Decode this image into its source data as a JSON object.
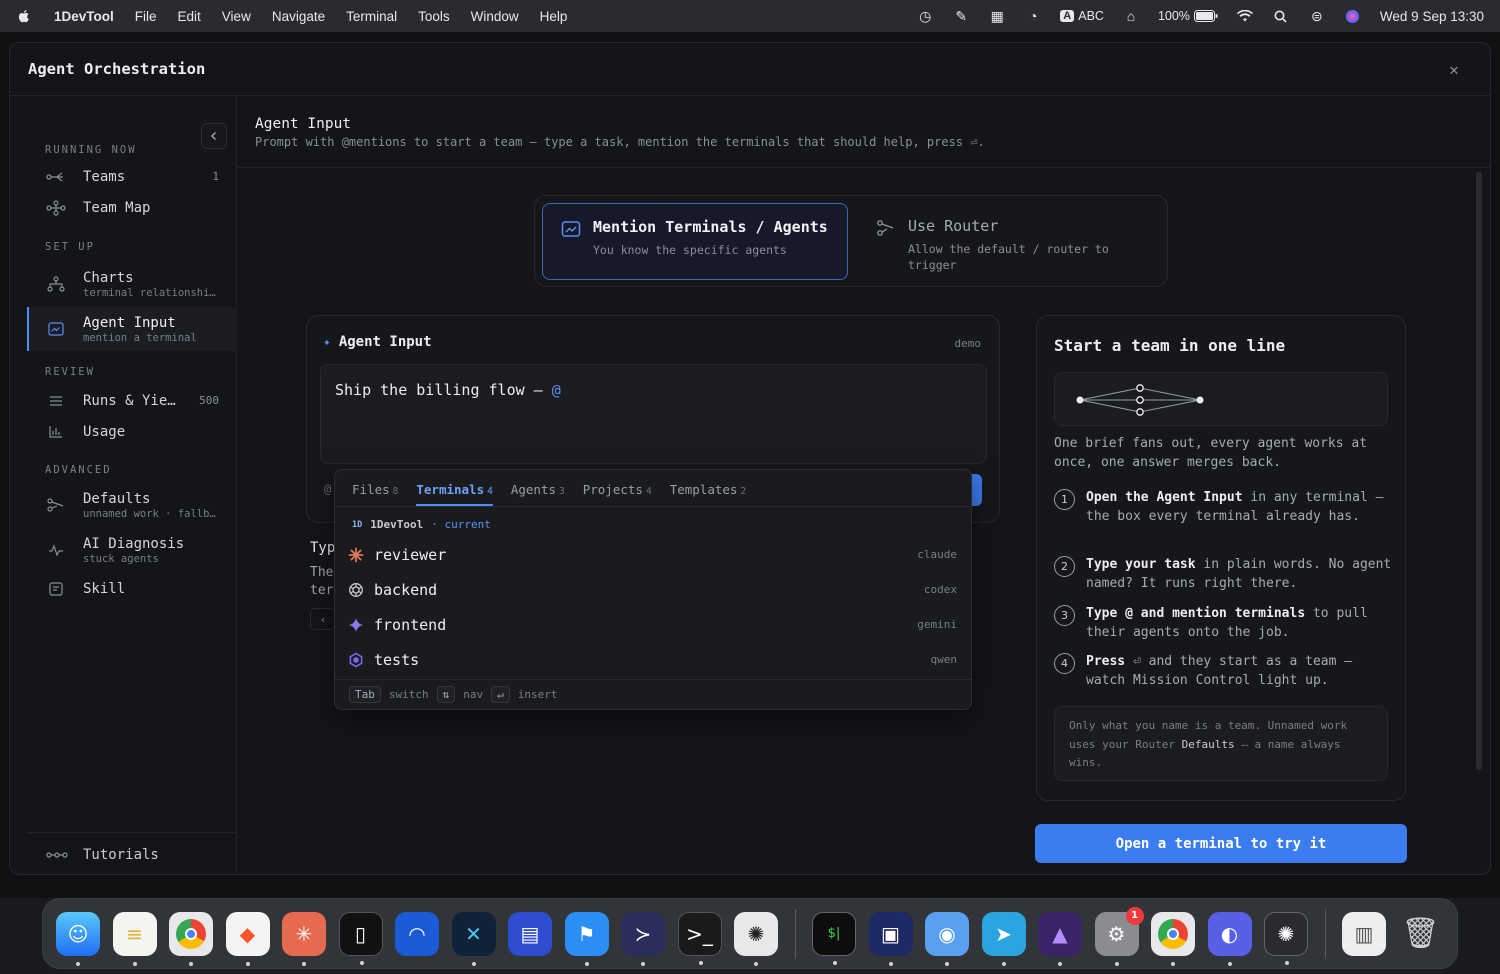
{
  "menubar": {
    "app_name": "1DevTool",
    "menus": [
      "File",
      "Edit",
      "View",
      "Navigate",
      "Terminal",
      "Tools",
      "Window",
      "Help"
    ],
    "input_source": "ABC",
    "battery": "100%",
    "datetime": "Wed 9 Sep  13:30"
  },
  "modal": {
    "title": "Agent Orchestration"
  },
  "sidebar": {
    "sections": {
      "running_now": "RUNNING NOW",
      "set_up": "SET UP",
      "review": "REVIEW",
      "advanced": "ADVANCED"
    },
    "items": {
      "teams": {
        "label": "Teams",
        "count": "1"
      },
      "team_map": {
        "label": "Team Map"
      },
      "charts": {
        "label": "Charts",
        "sub": "terminal relationshi…"
      },
      "agent_input": {
        "label": "Agent Input",
        "sub": "mention a terminal"
      },
      "runs": {
        "label": "Runs & Yie…",
        "count": "500"
      },
      "usage": {
        "label": "Usage"
      },
      "defaults": {
        "label": "Defaults",
        "sub": "unnamed work · fallb…"
      },
      "ai_diagnosis": {
        "label": "AI Diagnosis",
        "sub": "stuck agents"
      },
      "skill": {
        "label": "Skill"
      }
    },
    "footer": {
      "label": "Tutorials"
    }
  },
  "content": {
    "title": "Agent Input",
    "subtitle": "Prompt with @mentions to start a team — type a task, mention the terminals that should help, press ⏎."
  },
  "mode_toggle": {
    "mention": {
      "title": "Mention Terminals / Agents",
      "sub": "You know the specific agents"
    },
    "router": {
      "title": "Use Router",
      "sub": "Allow the default / router to trigger"
    }
  },
  "input_card": {
    "title": "Agent Input",
    "tag": "demo",
    "text": "Ship the billing flow — ",
    "at": "@",
    "left_edge": "@"
  },
  "occluded": {
    "heading": "Typ",
    "line1": "The",
    "line2": "ter",
    "btn": "‹"
  },
  "popup": {
    "tabs": [
      {
        "label": "Files",
        "count": "8"
      },
      {
        "label": "Terminals",
        "count": "4"
      },
      {
        "label": "Agents",
        "count": "3"
      },
      {
        "label": "Projects",
        "count": "4"
      },
      {
        "label": "Templates",
        "count": "2"
      }
    ],
    "group": {
      "badge": "1D",
      "name": "1DevTool",
      "current": "· current"
    },
    "rows": [
      {
        "name": "reviewer",
        "agent": "claude"
      },
      {
        "name": "backend",
        "agent": "codex"
      },
      {
        "name": "frontend",
        "agent": "gemini"
      },
      {
        "name": "tests",
        "agent": "qwen"
      }
    ],
    "footer": {
      "tab": "Tab",
      "switch": "switch",
      "nav_key": "⇅",
      "nav": "nav",
      "insert_key": "↵",
      "insert": "insert"
    }
  },
  "team_card": {
    "title": "Start a team in one line",
    "desc": "One brief fans out, every agent works at once, one answer merges back.",
    "steps": [
      {
        "num": "1",
        "bold": "Open the Agent Input",
        "rest": " in any terminal — the box every terminal already has."
      },
      {
        "num": "2",
        "bold": "Type your task",
        "rest": " in plain words. No agent named? It runs right there."
      },
      {
        "num": "3",
        "bold": "Type @ and mention terminals",
        "rest": " to pull their agents onto the job."
      },
      {
        "num": "4",
        "bold": "Press",
        "rest": " ⏎ and they start as a team — watch Mission Control light up."
      }
    ],
    "note_pre": "Only what you name is a team. Unnamed work uses your Router ",
    "note_bold": "Defaults",
    "note_post": " — a name always wins."
  },
  "cta": {
    "label": "Open a terminal to try it"
  },
  "dock": {
    "badge": "1",
    "apps": [
      "finder",
      "notes",
      "chrome",
      "brave",
      "claude",
      "1devtool",
      "app-blue",
      "app-cross",
      "app-doc",
      "app-flag",
      "powershell",
      "terminal",
      "chatgpt",
      "iterm",
      "app-finder2",
      "app-vpn",
      "telegram",
      "app-purple",
      "settings",
      "chrome2",
      "app-chat",
      "chatgpt2",
      "doc",
      "trash"
    ]
  },
  "colors": {
    "accent": "#3b7cf0",
    "background": "#141518"
  }
}
